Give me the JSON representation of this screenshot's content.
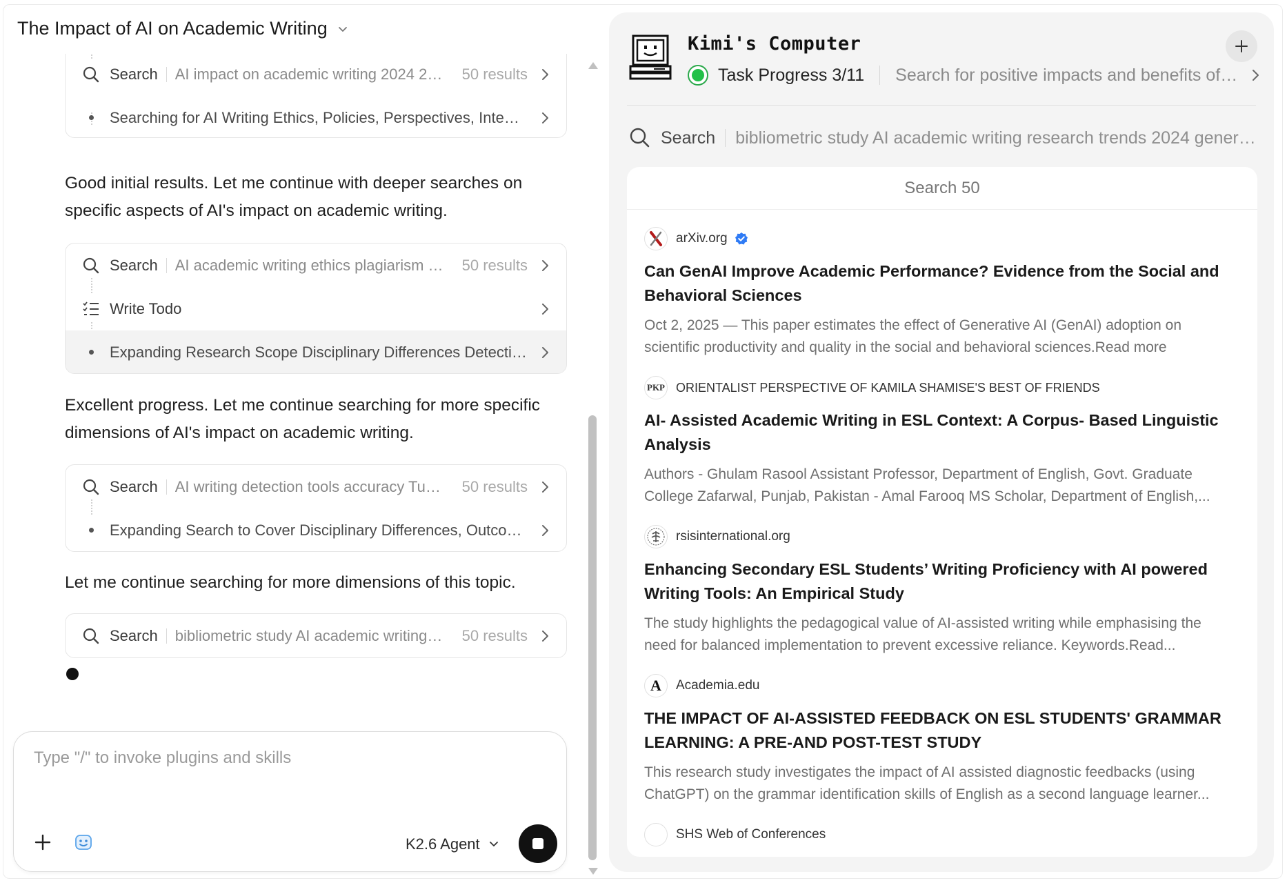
{
  "chat": {
    "title": "The Impact of AI on Academic Writing",
    "groups": [
      {
        "rows": [
          {
            "kind": "search",
            "label": "Search",
            "query": "AI impact on academic writing 2024 202...",
            "count": "50 results"
          },
          {
            "kind": "step",
            "text": "Searching for AI Writing Ethics, Policies, Perspectives, Integrit..."
          }
        ]
      },
      {
        "rows": [
          {
            "kind": "search",
            "label": "Search",
            "query": "AI academic writing ethics plagiarism con...",
            "count": "50 results"
          },
          {
            "kind": "todo",
            "label": "Write Todo"
          },
          {
            "kind": "step",
            "text": "Expanding Research Scope Disciplinary Differences Detectio..."
          }
        ]
      },
      {
        "rows": [
          {
            "kind": "search",
            "label": "Search",
            "query": "AI writing detection tools accuracy Turnit...",
            "count": "50 results"
          },
          {
            "kind": "step",
            "text": "Expanding Search to Cover Disciplinary Differences, Outcom..."
          }
        ]
      },
      {
        "rows": [
          {
            "kind": "search",
            "label": "Search",
            "query": "bibliometric study AI academic writing re...",
            "count": "50 results"
          }
        ]
      }
    ],
    "messages": [
      "Good initial results. Let me continue with deeper searches on specific aspects of AI's impact on academic writing.",
      "Excellent progress. Let me continue searching for more specific dimensions of AI's impact on academic writing.",
      "Let me continue searching for more dimensions of this topic."
    ],
    "composer": {
      "placeholder": "Type \"/\" to invoke plugins and skills",
      "model": "K2.6 Agent"
    }
  },
  "computer": {
    "title": "Kimi's Computer",
    "progress_label": "Task Progress 3/11",
    "progress_fraction": 0.2727,
    "current_step": "Search for positive impacts and benefits of AI ...",
    "search_label": "Search",
    "search_query": "bibliometric study AI academic writing research trends 2024 genera...",
    "results_header": "Search 50",
    "results": [
      {
        "source": "arXiv.org",
        "verified": true,
        "favicon": "arxiv-icon",
        "title": "Can GenAI Improve Academic Performance? Evidence from the Social and Behavioral Sciences",
        "snippet": "Oct 2, 2025 — This paper estimates the effect of Generative AI (GenAI) adoption on scientific productivity and quality in the social and behavioral sciences.Read more"
      },
      {
        "source": "ORIENTALIST PERSPECTIVE OF KAMILA SHAMISE'S BEST OF FRIENDS",
        "verified": false,
        "favicon": "pkp-icon",
        "favicon_text": "PKP",
        "title": "AI- Assisted Academic Writing in ESL Context: A Corpus- Based Linguistic Analysis",
        "snippet": "Authors - Ghulam Rasool Assistant Professor, Department of English, Govt. Graduate College Zafarwal, Punjab, Pakistan - Amal Farooq MS Scholar, Department of English,..."
      },
      {
        "source": "rsisinternational.org",
        "verified": false,
        "favicon": "rsis-emblem-icon",
        "title": "Enhancing Secondary ESL Students’ Writing Proficiency with AI powered Writing Tools: An Empirical Study",
        "snippet": "The study highlights the pedagogical value of AI-assisted writing while emphasising the need for balanced implementation to prevent excessive reliance. Keywords.Read..."
      },
      {
        "source": "Academia.edu",
        "verified": false,
        "favicon": "academia-icon",
        "favicon_text": "A",
        "title": "THE IMPACT OF AI-ASSISTED FEEDBACK ON ESL STUDENTS' GRAMMAR LEARNING: A PRE-AND POST-TEST STUDY",
        "snippet": "This research study investigates the impact of AI assisted diagnostic feedbacks (using ChatGPT) on the grammar identification skills of English as a second language learner..."
      },
      {
        "source": "SHS Web of Conferences",
        "verified": false,
        "favicon": "blank-favicon-icon"
      }
    ]
  },
  "colors": {
    "status_green": "#22c048",
    "verified_blue": "#2f7bf5",
    "panel_bg": "#f4f4f4"
  }
}
